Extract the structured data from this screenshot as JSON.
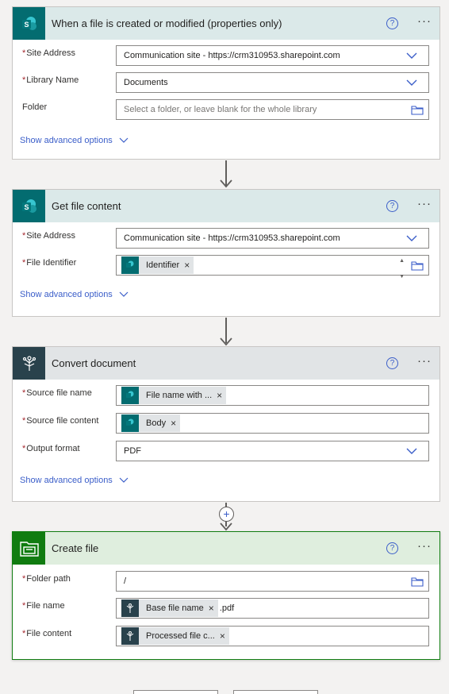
{
  "cards": {
    "trigger": {
      "title": "When a file is created or modified (properties only)",
      "site_address_label": "Site Address",
      "site_address_value": "Communication site - https://crm310953.sharepoint.com",
      "library_label": "Library Name",
      "library_value": "Documents",
      "folder_label": "Folder",
      "folder_placeholder": "Select a folder, or leave blank for the whole library",
      "advanced": "Show advanced options"
    },
    "get_file": {
      "title": "Get file content",
      "site_address_label": "Site Address",
      "site_address_value": "Communication site - https://crm310953.sharepoint.com",
      "file_id_label": "File Identifier",
      "file_id_token": "Identifier",
      "advanced": "Show advanced options"
    },
    "convert": {
      "title": "Convert document",
      "source_name_label": "Source file name",
      "source_name_token": "File name with ...",
      "source_content_label": "Source file content",
      "source_content_token": "Body",
      "output_format_label": "Output format",
      "output_format_value": "PDF",
      "advanced": "Show advanced options"
    },
    "create": {
      "title": "Create file",
      "folder_path_label": "Folder path",
      "folder_path_value": "/",
      "file_name_label": "File name",
      "file_name_token": "Base file name",
      "file_name_suffix": ".pdf",
      "file_content_label": "File content",
      "file_content_token": "Processed file c..."
    }
  },
  "common": {
    "required_marker": "*",
    "help_glyph": "?",
    "more_glyph": "···",
    "remove_glyph": "×",
    "add_glyph": "+"
  },
  "colors": {
    "sharepoint": "#036c70",
    "converter": "#29424c",
    "create": "#107c10",
    "link": "#3b5ec9"
  }
}
